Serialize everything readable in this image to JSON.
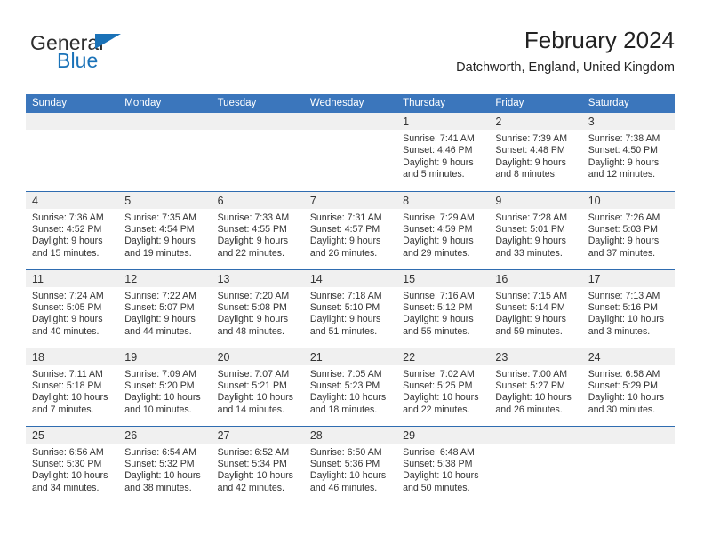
{
  "logo": {
    "word_one": "General",
    "word_two": "Blue",
    "flag_icon": "triangle-flag-icon",
    "color_dark": "#2e2e2e",
    "color_blue": "#1a72b8"
  },
  "header": {
    "title": "February 2024",
    "subtitle": "Datchworth, England, United Kingdom"
  },
  "theme": {
    "header_blue": "#3b76bc",
    "rule_blue": "#2f6cb0",
    "daynum_strip": "#f0f0f0",
    "text": "#333333"
  },
  "weekdays": [
    "Sunday",
    "Monday",
    "Tuesday",
    "Wednesday",
    "Thursday",
    "Friday",
    "Saturday"
  ],
  "weeks": [
    [
      {
        "day": "",
        "sunrise": "",
        "sunset": "",
        "daylight1": "",
        "daylight2": ""
      },
      {
        "day": "",
        "sunrise": "",
        "sunset": "",
        "daylight1": "",
        "daylight2": ""
      },
      {
        "day": "",
        "sunrise": "",
        "sunset": "",
        "daylight1": "",
        "daylight2": ""
      },
      {
        "day": "",
        "sunrise": "",
        "sunset": "",
        "daylight1": "",
        "daylight2": ""
      },
      {
        "day": "1",
        "sunrise": "Sunrise: 7:41 AM",
        "sunset": "Sunset: 4:46 PM",
        "daylight1": "Daylight: 9 hours",
        "daylight2": "and 5 minutes."
      },
      {
        "day": "2",
        "sunrise": "Sunrise: 7:39 AM",
        "sunset": "Sunset: 4:48 PM",
        "daylight1": "Daylight: 9 hours",
        "daylight2": "and 8 minutes."
      },
      {
        "day": "3",
        "sunrise": "Sunrise: 7:38 AM",
        "sunset": "Sunset: 4:50 PM",
        "daylight1": "Daylight: 9 hours",
        "daylight2": "and 12 minutes."
      }
    ],
    [
      {
        "day": "4",
        "sunrise": "Sunrise: 7:36 AM",
        "sunset": "Sunset: 4:52 PM",
        "daylight1": "Daylight: 9 hours",
        "daylight2": "and 15 minutes."
      },
      {
        "day": "5",
        "sunrise": "Sunrise: 7:35 AM",
        "sunset": "Sunset: 4:54 PM",
        "daylight1": "Daylight: 9 hours",
        "daylight2": "and 19 minutes."
      },
      {
        "day": "6",
        "sunrise": "Sunrise: 7:33 AM",
        "sunset": "Sunset: 4:55 PM",
        "daylight1": "Daylight: 9 hours",
        "daylight2": "and 22 minutes."
      },
      {
        "day": "7",
        "sunrise": "Sunrise: 7:31 AM",
        "sunset": "Sunset: 4:57 PM",
        "daylight1": "Daylight: 9 hours",
        "daylight2": "and 26 minutes."
      },
      {
        "day": "8",
        "sunrise": "Sunrise: 7:29 AM",
        "sunset": "Sunset: 4:59 PM",
        "daylight1": "Daylight: 9 hours",
        "daylight2": "and 29 minutes."
      },
      {
        "day": "9",
        "sunrise": "Sunrise: 7:28 AM",
        "sunset": "Sunset: 5:01 PM",
        "daylight1": "Daylight: 9 hours",
        "daylight2": "and 33 minutes."
      },
      {
        "day": "10",
        "sunrise": "Sunrise: 7:26 AM",
        "sunset": "Sunset: 5:03 PM",
        "daylight1": "Daylight: 9 hours",
        "daylight2": "and 37 minutes."
      }
    ],
    [
      {
        "day": "11",
        "sunrise": "Sunrise: 7:24 AM",
        "sunset": "Sunset: 5:05 PM",
        "daylight1": "Daylight: 9 hours",
        "daylight2": "and 40 minutes."
      },
      {
        "day": "12",
        "sunrise": "Sunrise: 7:22 AM",
        "sunset": "Sunset: 5:07 PM",
        "daylight1": "Daylight: 9 hours",
        "daylight2": "and 44 minutes."
      },
      {
        "day": "13",
        "sunrise": "Sunrise: 7:20 AM",
        "sunset": "Sunset: 5:08 PM",
        "daylight1": "Daylight: 9 hours",
        "daylight2": "and 48 minutes."
      },
      {
        "day": "14",
        "sunrise": "Sunrise: 7:18 AM",
        "sunset": "Sunset: 5:10 PM",
        "daylight1": "Daylight: 9 hours",
        "daylight2": "and 51 minutes."
      },
      {
        "day": "15",
        "sunrise": "Sunrise: 7:16 AM",
        "sunset": "Sunset: 5:12 PM",
        "daylight1": "Daylight: 9 hours",
        "daylight2": "and 55 minutes."
      },
      {
        "day": "16",
        "sunrise": "Sunrise: 7:15 AM",
        "sunset": "Sunset: 5:14 PM",
        "daylight1": "Daylight: 9 hours",
        "daylight2": "and 59 minutes."
      },
      {
        "day": "17",
        "sunrise": "Sunrise: 7:13 AM",
        "sunset": "Sunset: 5:16 PM",
        "daylight1": "Daylight: 10 hours",
        "daylight2": "and 3 minutes."
      }
    ],
    [
      {
        "day": "18",
        "sunrise": "Sunrise: 7:11 AM",
        "sunset": "Sunset: 5:18 PM",
        "daylight1": "Daylight: 10 hours",
        "daylight2": "and 7 minutes."
      },
      {
        "day": "19",
        "sunrise": "Sunrise: 7:09 AM",
        "sunset": "Sunset: 5:20 PM",
        "daylight1": "Daylight: 10 hours",
        "daylight2": "and 10 minutes."
      },
      {
        "day": "20",
        "sunrise": "Sunrise: 7:07 AM",
        "sunset": "Sunset: 5:21 PM",
        "daylight1": "Daylight: 10 hours",
        "daylight2": "and 14 minutes."
      },
      {
        "day": "21",
        "sunrise": "Sunrise: 7:05 AM",
        "sunset": "Sunset: 5:23 PM",
        "daylight1": "Daylight: 10 hours",
        "daylight2": "and 18 minutes."
      },
      {
        "day": "22",
        "sunrise": "Sunrise: 7:02 AM",
        "sunset": "Sunset: 5:25 PM",
        "daylight1": "Daylight: 10 hours",
        "daylight2": "and 22 minutes."
      },
      {
        "day": "23",
        "sunrise": "Sunrise: 7:00 AM",
        "sunset": "Sunset: 5:27 PM",
        "daylight1": "Daylight: 10 hours",
        "daylight2": "and 26 minutes."
      },
      {
        "day": "24",
        "sunrise": "Sunrise: 6:58 AM",
        "sunset": "Sunset: 5:29 PM",
        "daylight1": "Daylight: 10 hours",
        "daylight2": "and 30 minutes."
      }
    ],
    [
      {
        "day": "25",
        "sunrise": "Sunrise: 6:56 AM",
        "sunset": "Sunset: 5:30 PM",
        "daylight1": "Daylight: 10 hours",
        "daylight2": "and 34 minutes."
      },
      {
        "day": "26",
        "sunrise": "Sunrise: 6:54 AM",
        "sunset": "Sunset: 5:32 PM",
        "daylight1": "Daylight: 10 hours",
        "daylight2": "and 38 minutes."
      },
      {
        "day": "27",
        "sunrise": "Sunrise: 6:52 AM",
        "sunset": "Sunset: 5:34 PM",
        "daylight1": "Daylight: 10 hours",
        "daylight2": "and 42 minutes."
      },
      {
        "day": "28",
        "sunrise": "Sunrise: 6:50 AM",
        "sunset": "Sunset: 5:36 PM",
        "daylight1": "Daylight: 10 hours",
        "daylight2": "and 46 minutes."
      },
      {
        "day": "29",
        "sunrise": "Sunrise: 6:48 AM",
        "sunset": "Sunset: 5:38 PM",
        "daylight1": "Daylight: 10 hours",
        "daylight2": "and 50 minutes."
      },
      {
        "day": "",
        "sunrise": "",
        "sunset": "",
        "daylight1": "",
        "daylight2": ""
      },
      {
        "day": "",
        "sunrise": "",
        "sunset": "",
        "daylight1": "",
        "daylight2": ""
      }
    ]
  ]
}
